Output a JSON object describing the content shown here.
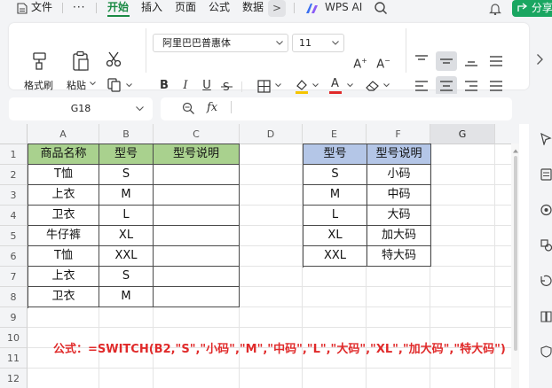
{
  "menu": {
    "tabs": [
      "文件",
      "开始",
      "插入",
      "页面",
      "公式",
      "数据"
    ],
    "active_tab": "开始",
    "more_label": ">",
    "wps_ai_label": "WPS AI",
    "share_label": "分享"
  },
  "ribbon": {
    "format_painter": "格式刷",
    "paste": "粘贴",
    "font_name": "阿里巴巴普惠体",
    "font_size": "11",
    "bold": "B",
    "italic": "I",
    "underline": "U",
    "increase_font": "A",
    "decrease_font": "A",
    "font_color_letter": "A"
  },
  "formula_bar": {
    "cell_ref": "G18",
    "fx_label": "fx",
    "content": ""
  },
  "grid": {
    "columns": [
      "A",
      "B",
      "C",
      "D",
      "E",
      "F",
      "G"
    ],
    "selected_column": "G",
    "rows": [
      "1",
      "2",
      "3",
      "4",
      "5",
      "6",
      "7",
      "8",
      "9",
      "10",
      "11",
      "12"
    ]
  },
  "table_left": {
    "headers": [
      "商品名称",
      "型号",
      "型号说明"
    ],
    "rows": [
      [
        "T恤",
        "S",
        ""
      ],
      [
        "上衣",
        "M",
        ""
      ],
      [
        "卫衣",
        "L",
        ""
      ],
      [
        "牛仔裤",
        "XL",
        ""
      ],
      [
        "T恤",
        "XXL",
        ""
      ],
      [
        "上衣",
        "S",
        ""
      ],
      [
        "卫衣",
        "M",
        ""
      ]
    ]
  },
  "table_right": {
    "headers": [
      "型号",
      "型号说明"
    ],
    "rows": [
      [
        "S",
        "小码"
      ],
      [
        "M",
        "中码"
      ],
      [
        "L",
        "大码"
      ],
      [
        "XL",
        "加大码"
      ],
      [
        "XXL",
        "特大码"
      ]
    ]
  },
  "formula_note": "公式：=SWITCH(B2,\"S\",\"小码\",\"M\",\"中码\",\"L\",\"大码\",\"XL\",\"加大码\",\"特大码\")",
  "colors": {
    "accent_green": "#1a8a44",
    "share_button": "#1aa661",
    "header_green": "#a9d18e",
    "header_blue": "#b4c6e7",
    "formula_red": "#e02a2a"
  },
  "icons": [
    "file-icon",
    "more-icon",
    "wps-ai-logo-icon",
    "search-icon",
    "bell-icon",
    "share-icon",
    "format-painter-icon",
    "paste-icon",
    "cut-icon",
    "copy-icon",
    "borders-icon",
    "fill-color-icon",
    "font-color-icon",
    "eraser-icon",
    "align-top-icon",
    "align-middle-icon",
    "align-bottom-icon",
    "align-left-icon",
    "align-center-icon",
    "align-right-icon",
    "zoom-icon",
    "fx-icon"
  ]
}
